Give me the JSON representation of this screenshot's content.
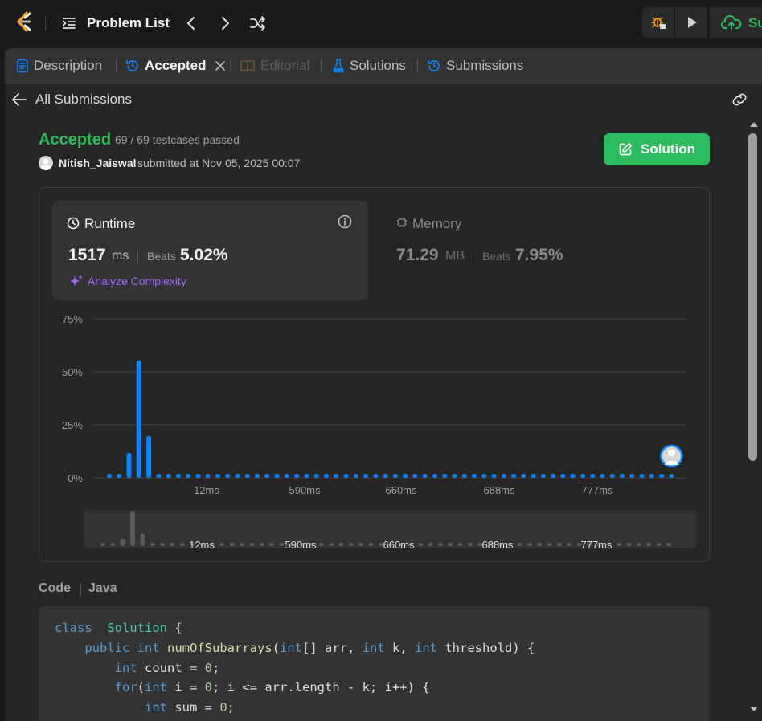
{
  "topnav": {
    "problem_list_label": "Problem List",
    "submit_label_partial": "Su"
  },
  "tabs": [
    {
      "label": "Description",
      "state": "normal"
    },
    {
      "label": "Accepted",
      "state": "active"
    },
    {
      "label": "Editorial",
      "state": "disabled"
    },
    {
      "label": "Solutions",
      "state": "normal"
    },
    {
      "label": "Submissions",
      "state": "normal"
    }
  ],
  "subbar": {
    "back_label": "All Submissions"
  },
  "submission": {
    "status": "Accepted",
    "testcases": "69 / 69 testcases passed",
    "user": "Nitish_Jaiswal",
    "submitted_at": "submitted at Nov 05, 2025 00:07",
    "solution_button": "Solution"
  },
  "runtime": {
    "title": "Runtime",
    "value": "1517",
    "unit": "ms",
    "beats_label": "Beats",
    "beats_value": "5.02%",
    "analyze_label": "Analyze Complexity"
  },
  "memory": {
    "title": "Memory",
    "value": "71.29",
    "unit": "MB",
    "beats_label": "Beats",
    "beats_value": "7.95%"
  },
  "colors": {
    "accepted": "#2cbb5d",
    "bar": "#0a84ff",
    "analyze": "#a066f5",
    "background": "#1a1a1a",
    "panel": "#262626"
  },
  "chart_data": {
    "type": "bar",
    "title": "",
    "xlabel": "",
    "ylabel": "",
    "ylim": [
      0,
      75
    ],
    "y_ticks": [
      "75%",
      "50%",
      "25%",
      "0%"
    ],
    "x_tick_labels": [
      "12ms",
      "590ms",
      "660ms",
      "688ms",
      "777ms"
    ],
    "values": [
      0.5,
      0.5,
      11.8,
      55.4,
      19.8,
      0.5,
      0.5,
      0.5,
      0.5,
      0.5,
      0.5,
      0.5,
      0.5,
      0.5,
      0.5,
      0.5,
      0.5,
      0.5,
      0.5,
      0.5,
      0.5,
      0.5,
      0.5,
      0.5,
      0.5,
      0.5,
      0.5,
      0.5,
      0.5,
      0.5,
      0.5,
      0.5,
      0.5,
      0.5,
      0.5,
      0.5,
      0.5,
      0.5,
      0.5,
      0.5,
      0.5,
      0.5,
      0.5,
      0.5,
      0.5,
      0.5,
      0.5,
      0.5,
      0.5,
      0.5,
      0.5,
      0.5,
      0.5,
      0.5,
      0.5,
      0.5,
      0.5,
      0.5
    ],
    "grid": true,
    "user_marker": "last bar"
  },
  "code": {
    "label": "Code",
    "language": "Java",
    "lines": [
      [
        [
          "kw",
          "class"
        ],
        [
          "",
          "  "
        ],
        [
          "cls",
          "Solution"
        ],
        [
          "",
          " {"
        ]
      ],
      [
        [
          "",
          "    "
        ],
        [
          "kw",
          "public"
        ],
        [
          "",
          " "
        ],
        [
          "kw",
          "int"
        ],
        [
          "",
          " "
        ],
        [
          "fn",
          "numOfSubarrays"
        ],
        [
          "",
          "("
        ],
        [
          "kw",
          "int"
        ],
        [
          "",
          "[] arr, "
        ],
        [
          "kw",
          "int"
        ],
        [
          "",
          " k, "
        ],
        [
          "kw",
          "int"
        ],
        [
          "",
          " threshold) {"
        ]
      ],
      [
        [
          "",
          "        "
        ],
        [
          "kw",
          "int"
        ],
        [
          "",
          " count = "
        ],
        [
          "num",
          "0"
        ],
        [
          "",
          ";"
        ]
      ],
      [
        [
          "",
          "        "
        ],
        [
          "kw",
          "for"
        ],
        [
          "",
          "("
        ],
        [
          "kw",
          "int"
        ],
        [
          "",
          " i = "
        ],
        [
          "num",
          "0"
        ],
        [
          "",
          "; i <= arr.length - k; i++) {"
        ]
      ],
      [
        [
          "",
          "            "
        ],
        [
          "kw",
          "int"
        ],
        [
          "",
          " sum = "
        ],
        [
          "num",
          "0"
        ],
        [
          "",
          ";"
        ]
      ]
    ]
  }
}
